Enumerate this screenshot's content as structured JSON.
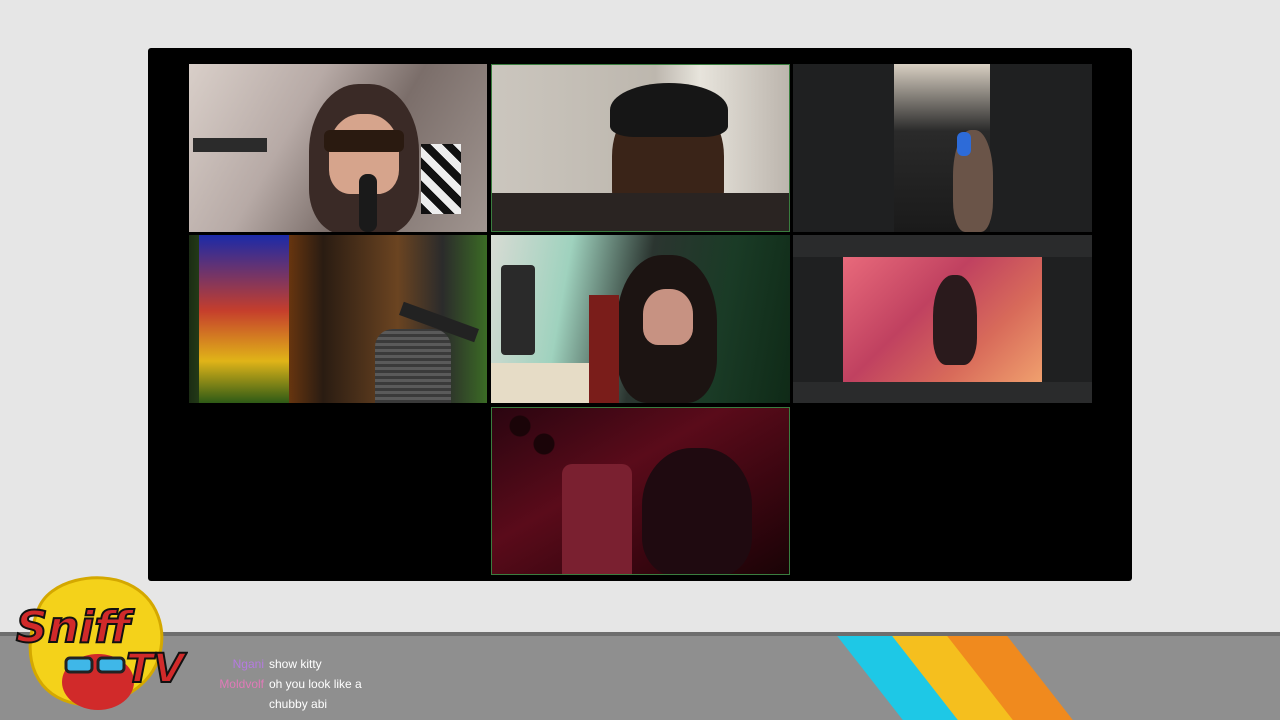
{
  "brand": {
    "logo_text_top": "Sniff",
    "logo_text_bottom": "TV"
  },
  "participants": [
    {
      "id": "p1",
      "speaking": false
    },
    {
      "id": "p2",
      "speaking": true
    },
    {
      "id": "p3",
      "speaking": false
    },
    {
      "id": "p4",
      "speaking": false
    },
    {
      "id": "p5",
      "speaking": false
    },
    {
      "id": "p6",
      "speaking": false
    },
    {
      "id": "p7",
      "speaking": true
    }
  ],
  "chat": {
    "messages": [
      {
        "user": "Ngani",
        "text": "show kitty",
        "user_color": "#b57ae0"
      },
      {
        "user": "Moldvolf",
        "text": "oh you look like a chubby abi",
        "user_color": "#e07ab8"
      }
    ]
  },
  "colors": {
    "stripe_cyan": "#1ec8e6",
    "stripe_yellow": "#f5bf1e",
    "stripe_orange": "#f08a1e",
    "speaking_border": "#3a7d3f"
  }
}
